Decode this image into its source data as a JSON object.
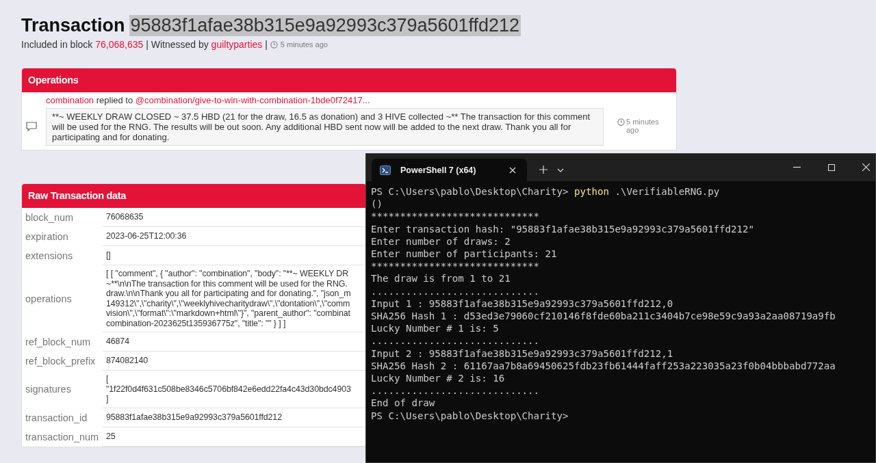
{
  "page": {
    "title": "Transaction",
    "hash": "95883f1afae38b315e9a92993c379a5601ffd212",
    "block_prefix": "Included in block",
    "block": "76,068,635",
    "witness_prefix": "| Witnessed by",
    "witness": "guiltyparties",
    "separator": "|",
    "time": "5 minutes ago"
  },
  "operations": {
    "title": "Operations",
    "items": [
      {
        "author": "combination",
        "action": "replied to",
        "target": "@combination/give-to-win-with-combination-1bde0f72417...",
        "body": "**~ WEEKLY DRAW CLOSED ~ 37.5 HBD (21 for the draw, 16.5 as donation) and 3 HIVE collected ~** The transaction for this comment will be used for the RNG. The results will be out soon. Any additional HBD sent now will be added to the next draw. Thank you all for participating and for donating.",
        "time": "5 minutes ago"
      }
    ]
  },
  "raw": {
    "title": "Raw Transaction data",
    "rows": [
      {
        "key": "block_num",
        "lines": [
          "76068635"
        ]
      },
      {
        "key": "expiration",
        "lines": [
          "2023-06-25T12:00:36"
        ]
      },
      {
        "key": "extensions",
        "lines": [
          "[]"
        ]
      },
      {
        "key": "operations",
        "lines": [
          "[ [ \"comment\", { \"author\": \"combination\", \"body\": \"**~ WEEKLY DR",
          "~**\\n\\nThe transaction for this comment will be used for the RNG.",
          "draw.\\n\\nThank you all for participating and for donating.\", \"json_m",
          "149312\\\",\\\"charity\\\",\\\"weeklyhivecharitydraw\\\",\\\"dontation\\\",\\\"comm",
          "vision\\\",\\\"format\\\":\\\"markdown+html\\\"}\", \"parent_author\": \"combinat",
          "combination-2023625t135936775z\", \"title\": \"\" } ] ]"
        ]
      },
      {
        "key": "ref_block_num",
        "lines": [
          "46874"
        ]
      },
      {
        "key": "ref_block_prefix",
        "lines": [
          "874082140"
        ]
      },
      {
        "key": "signatures",
        "lines": [
          "[",
          "\"1f22f0d4f631c508be8346c5706bf842e6edd22fa4c43d30bdc4903",
          "]"
        ]
      },
      {
        "key": "transaction_id",
        "lines": [
          "95883f1afae38b315e9a92993c379a5601ffd212"
        ]
      },
      {
        "key": "transaction_num",
        "lines": [
          "25"
        ]
      }
    ]
  },
  "terminal": {
    "tabs": [
      {
        "title": "PowerShell 7 (x64)",
        "selected": true
      }
    ],
    "lines": [
      {
        "kind": "prompt",
        "prompt": "PS C:\\Users\\pablo\\Desktop\\Charity>",
        "command": "python",
        "args": ".\\VerifiableRNG.py"
      },
      {
        "kind": "output",
        "text": "()"
      },
      {
        "kind": "output",
        "text": "*****************************"
      },
      {
        "kind": "output",
        "text": "Enter transaction hash: \"95883f1afae38b315e9a92993c379a5601ffd212\""
      },
      {
        "kind": "output",
        "text": "Enter number of draws: 2"
      },
      {
        "kind": "output",
        "text": "Enter number of participants: 21"
      },
      {
        "kind": "output",
        "text": "*****************************"
      },
      {
        "kind": "output",
        "text": "The draw is from 1 to 21"
      },
      {
        "kind": "output",
        "text": "............................."
      },
      {
        "kind": "output",
        "text": "Input 1 : 95883f1afae38b315e9a92993c379a5601ffd212,0"
      },
      {
        "kind": "output",
        "text": "SHA256 Hash 1 : d53ed3e79060cf210146f8fde60ba211c3404b7ce98e59c9a93a2aa08719a9fb"
      },
      {
        "kind": "output",
        "text": "Lucky Number # 1 is: 5"
      },
      {
        "kind": "output",
        "text": "............................."
      },
      {
        "kind": "output",
        "text": "Input 2 : 95883f1afae38b315e9a92993c379a5601ffd212,1"
      },
      {
        "kind": "output",
        "text": "SHA256 Hash 2 : 61167aa7b8a69450625fdb23fb61444faff253a223035a23f0b04bbbabd772aa"
      },
      {
        "kind": "output",
        "text": "Lucky Number # 2 is: 16"
      },
      {
        "kind": "output",
        "text": "............................."
      },
      {
        "kind": "output",
        "text": "End of draw"
      },
      {
        "kind": "prompt",
        "prompt": "PS C:\\Users\\pablo\\Desktop\\Charity>"
      }
    ]
  }
}
